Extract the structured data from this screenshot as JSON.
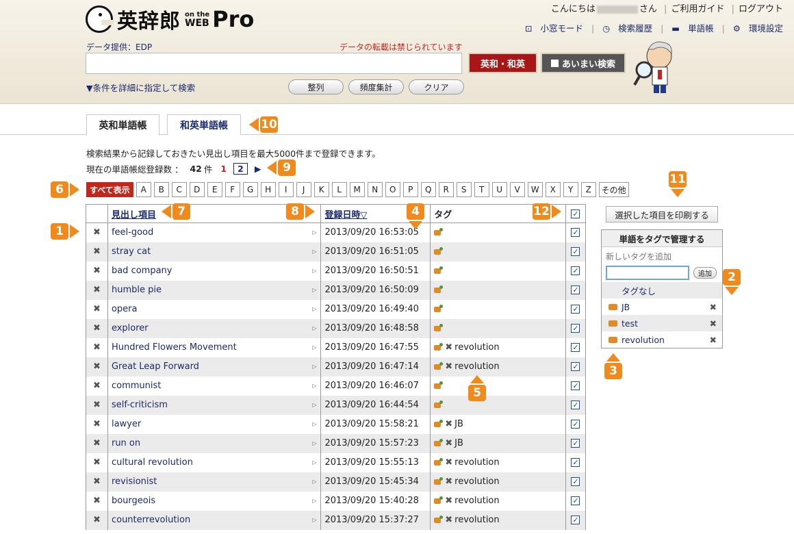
{
  "header": {
    "logo_kanji": "英辞郎",
    "logo_on_the": "on the",
    "logo_web": "WEB",
    "logo_pro": "Pro",
    "greeting_pre": "こんにちは",
    "greeting_post": "さん",
    "guide": "ご利用ガイド",
    "logout": "ログアウト",
    "links": {
      "window": "小窓モード",
      "history": "検索履歴",
      "wordbook": "単語帳",
      "settings": "環境設定"
    },
    "provider": "データ提供：EDP",
    "notice": "データの転載は禁じられています",
    "search_value": "",
    "btn_eiwa": "英和・和英",
    "btn_aimai": "あいまい検索",
    "detail_link": "▼条件を詳細に指定して検索",
    "btn_sort": "整列",
    "btn_freq": "頻度集計",
    "btn_clear": "クリア"
  },
  "tabs": {
    "eiwa": "英和単語帳",
    "waei": "和英単語帳"
  },
  "info": {
    "desc": "検索結果から記録しておきたい見出し項目を最大5000件まで登録できます。",
    "count_label": "現在の単語帳総登録数 ：",
    "count": "42",
    "count_unit": "件",
    "page1": "1",
    "page2": "2",
    "next": "▶"
  },
  "alpha": {
    "all": "すべて表示",
    "letters": [
      "A",
      "B",
      "C",
      "D",
      "E",
      "F",
      "G",
      "H",
      "I",
      "J",
      "K",
      "L",
      "M",
      "N",
      "O",
      "P",
      "Q",
      "R",
      "S",
      "T",
      "U",
      "V",
      "W",
      "X",
      "Y",
      "Z"
    ],
    "other": "その他"
  },
  "table": {
    "col_word": "見出し項目",
    "col_date": "登録日時▽",
    "col_tag": "タグ",
    "rows": [
      {
        "word": "feel-good",
        "date": "2013/09/20 16:53:05",
        "tag": ""
      },
      {
        "word": "stray cat",
        "date": "2013/09/20 16:51:05",
        "tag": ""
      },
      {
        "word": "bad company",
        "date": "2013/09/20 16:50:51",
        "tag": ""
      },
      {
        "word": "humble pie",
        "date": "2013/09/20 16:50:09",
        "tag": ""
      },
      {
        "word": "opera",
        "date": "2013/09/20 16:49:40",
        "tag": ""
      },
      {
        "word": "explorer",
        "date": "2013/09/20 16:48:58",
        "tag": ""
      },
      {
        "word": "Hundred Flowers Movement",
        "date": "2013/09/20 16:47:55",
        "tag": "revolution"
      },
      {
        "word": "Great Leap Forward",
        "date": "2013/09/20 16:47:14",
        "tag": "revolution"
      },
      {
        "word": "communist",
        "date": "2013/09/20 16:46:07",
        "tag": ""
      },
      {
        "word": "self-criticism",
        "date": "2013/09/20 16:44:54",
        "tag": ""
      },
      {
        "word": "lawyer",
        "date": "2013/09/20 15:58:21",
        "tag": "JB"
      },
      {
        "word": "run on",
        "date": "2013/09/20 15:57:23",
        "tag": "JB"
      },
      {
        "word": "cultural revolution",
        "date": "2013/09/20 15:55:13",
        "tag": "revolution"
      },
      {
        "word": "revisionist",
        "date": "2013/09/20 15:45:34",
        "tag": "revolution"
      },
      {
        "word": "bourgeois",
        "date": "2013/09/20 15:40:28",
        "tag": "revolution"
      },
      {
        "word": "counterrevolution",
        "date": "2013/09/20 15:37:27",
        "tag": "revolution"
      }
    ]
  },
  "side": {
    "print_btn": "選択した項目を印刷する",
    "panel_title": "単語をタグで管理する",
    "new_tag_label": "新しいタグを追加",
    "add_btn": "追加",
    "no_tag": "タグなし",
    "tags": [
      "JB",
      "test",
      "revolution"
    ]
  },
  "annotations": [
    "1",
    "2",
    "3",
    "4",
    "5",
    "6",
    "7",
    "8",
    "9",
    "10",
    "11",
    "12"
  ],
  "colors": {
    "accent_red": "#c0281e",
    "link_blue": "#1a2a6c",
    "annotation_orange": "#f08a1c"
  }
}
